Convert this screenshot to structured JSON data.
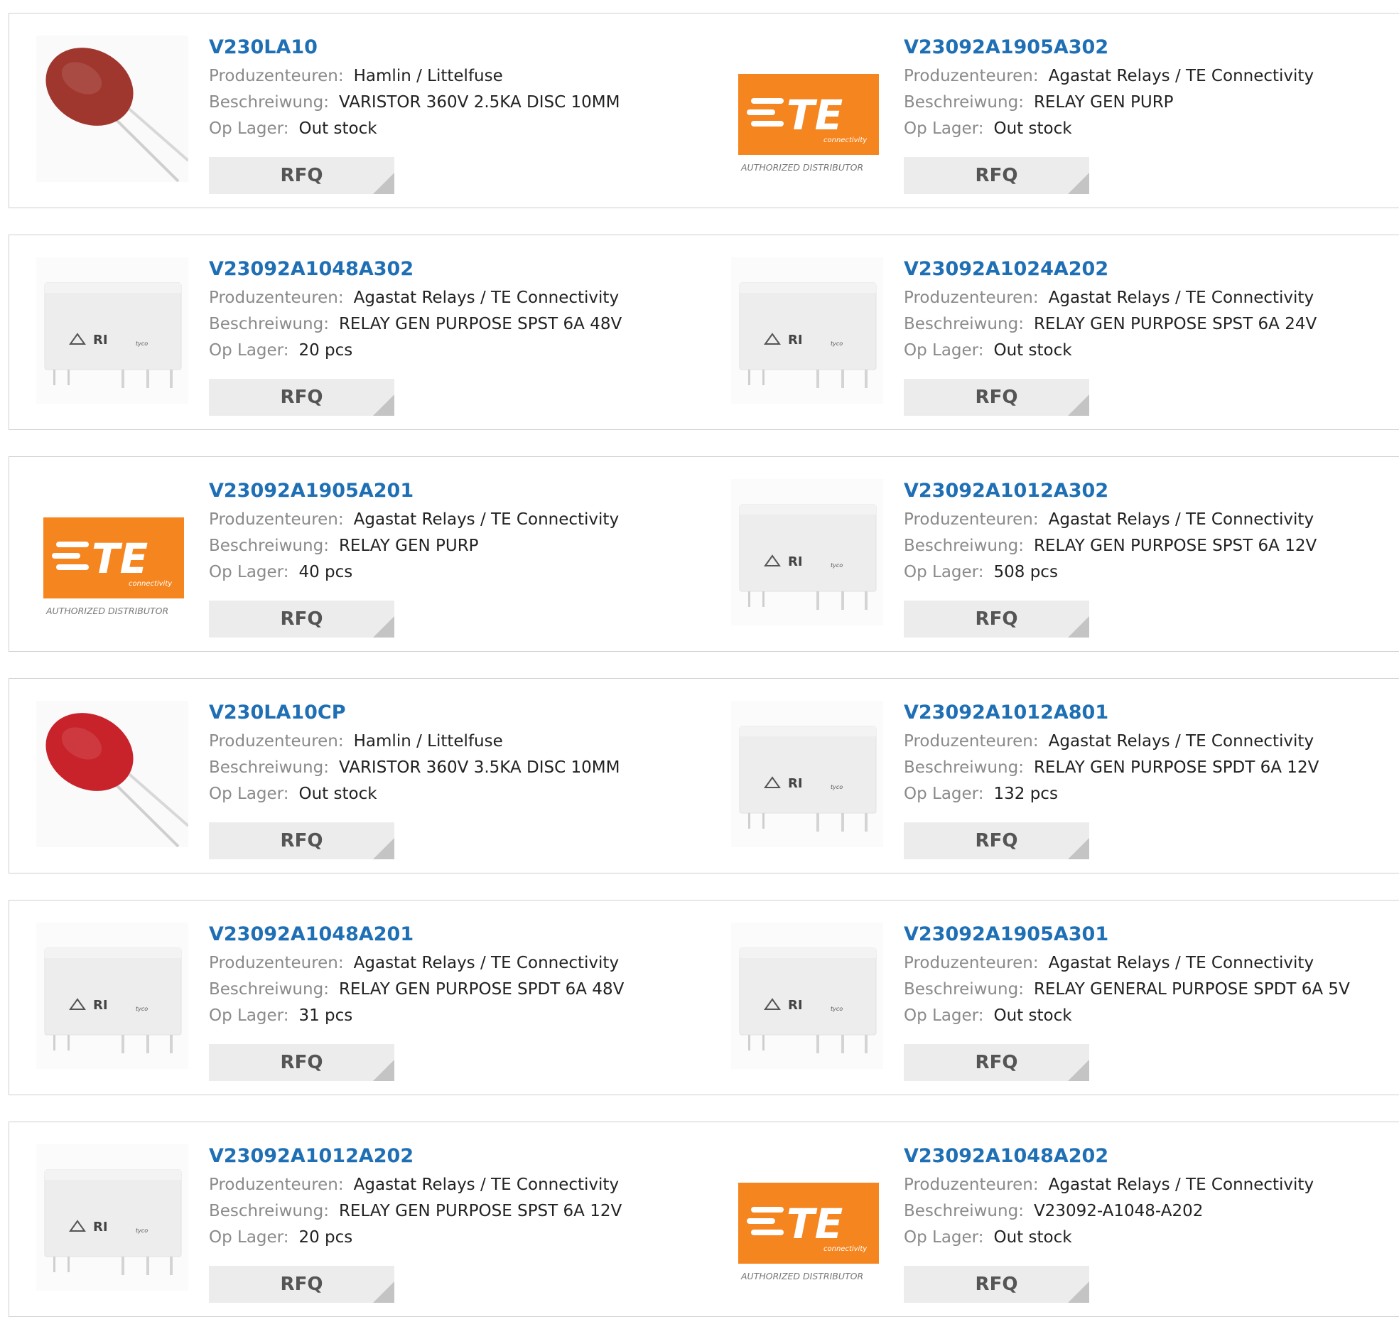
{
  "labels": {
    "manufacturer": "Produzenteuren:",
    "description": "Beschreiwung:",
    "stock": "Op Lager:",
    "rfq": "RFQ",
    "te_logo": "TE",
    "te_sub": "connectivity",
    "te_authorized": "AUTHORIZED DISTRIBUTOR"
  },
  "colors": {
    "link": "#1f6fb5",
    "te_orange": "#f5851f",
    "varistor_dark": "#a0372e",
    "varistor_red": "#c8232a"
  },
  "products": [
    {
      "part": "V230LA10",
      "manufacturer": "Hamlin / Littelfuse",
      "description": "VARISTOR 360V 2.5KA DISC 10MM",
      "stock": "Out stock",
      "image": "varistor-dark"
    },
    {
      "part": "V23092A1905A302",
      "manufacturer": "Agastat Relays / TE Connectivity",
      "description": "RELAY GEN PURP",
      "stock": "Out stock",
      "image": "te-logo"
    },
    {
      "part": "V23092A1048A302",
      "manufacturer": "Agastat Relays / TE Connectivity",
      "description": "RELAY GEN PURPOSE SPST 6A 48V",
      "stock": "20 pcs",
      "image": "relay"
    },
    {
      "part": "V23092A1024A202",
      "manufacturer": "Agastat Relays / TE Connectivity",
      "description": "RELAY GEN PURPOSE SPST 6A 24V",
      "stock": "Out stock",
      "image": "relay"
    },
    {
      "part": "V23092A1905A201",
      "manufacturer": "Agastat Relays / TE Connectivity",
      "description": "RELAY GEN PURP",
      "stock": "40 pcs",
      "image": "te-logo"
    },
    {
      "part": "V23092A1012A302",
      "manufacturer": "Agastat Relays / TE Connectivity",
      "description": "RELAY GEN PURPOSE SPST 6A 12V",
      "stock": "508 pcs",
      "image": "relay"
    },
    {
      "part": "V230LA10CP",
      "manufacturer": "Hamlin / Littelfuse",
      "description": "VARISTOR 360V 3.5KA DISC 10MM",
      "stock": "Out stock",
      "image": "varistor-red"
    },
    {
      "part": "V23092A1012A801",
      "manufacturer": "Agastat Relays / TE Connectivity",
      "description": "RELAY GEN PURPOSE SPDT 6A 12V",
      "stock": "132 pcs",
      "image": "relay"
    },
    {
      "part": "V23092A1048A201",
      "manufacturer": "Agastat Relays / TE Connectivity",
      "description": "RELAY GEN PURPOSE SPDT 6A 48V",
      "stock": "31 pcs",
      "image": "relay"
    },
    {
      "part": "V23092A1905A301",
      "manufacturer": "Agastat Relays / TE Connectivity",
      "description": "RELAY GENERAL PURPOSE SPDT 6A 5V",
      "stock": "Out stock",
      "image": "relay"
    },
    {
      "part": "V23092A1012A202",
      "manufacturer": "Agastat Relays / TE Connectivity",
      "description": "RELAY GEN PURPOSE SPST 6A 12V",
      "stock": "20 pcs",
      "image": "relay"
    },
    {
      "part": "V23092A1048A202",
      "manufacturer": "Agastat Relays / TE Connectivity",
      "description": "V23092-A1048-A202",
      "stock": "Out stock",
      "image": "te-logo"
    }
  ]
}
